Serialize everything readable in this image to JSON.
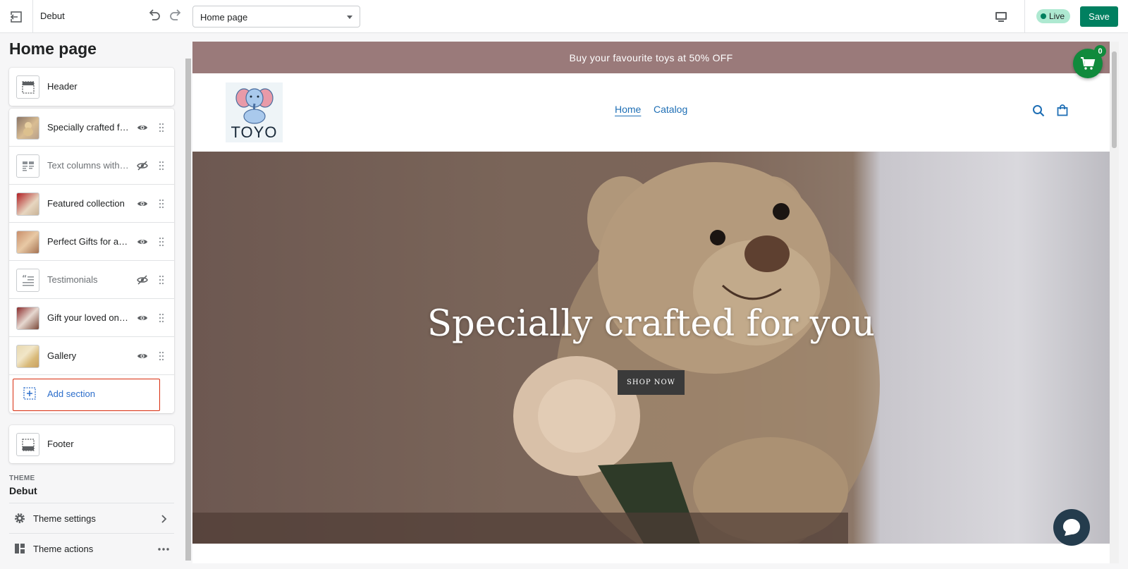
{
  "topbar": {
    "theme_name": "Debut",
    "page_select": "Home page",
    "live_label": "Live",
    "save_label": "Save"
  },
  "sidebar": {
    "title": "Home page",
    "header_label": "Header",
    "sections": [
      {
        "label": "Specially crafted for you",
        "visible": true
      },
      {
        "label": "Text columns with images",
        "visible": false
      },
      {
        "label": "Featured collection",
        "visible": true
      },
      {
        "label": "Perfect Gifts for all occasions",
        "visible": true
      },
      {
        "label": "Testimonials",
        "visible": false
      },
      {
        "label": "Gift your loved ones!",
        "visible": true
      },
      {
        "label": "Gallery",
        "visible": true
      }
    ],
    "add_section_label": "Add section",
    "footer_label": "Footer",
    "theme_heading": "THEME",
    "theme_current": "Debut",
    "theme_settings_label": "Theme settings",
    "theme_actions_label": "Theme actions"
  },
  "preview": {
    "announcement": "Buy your favourite toys at 50% OFF",
    "logo_text": "TOYO",
    "nav": {
      "home": "Home",
      "catalog": "Catalog"
    },
    "hero_title": "Specially crafted for you",
    "hero_button": "SHOP NOW",
    "cart_count": "0"
  }
}
